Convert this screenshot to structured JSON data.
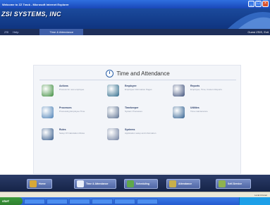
{
  "window": {
    "title": "Welcome to ZZ Track - Microsoft Internet Explorer"
  },
  "banner": {
    "brand": "ZSI SYSTEMS, INC"
  },
  "nav": {
    "items": [
      "ZSI",
      "Help"
    ],
    "active": "Time & Attendance",
    "user": "Guest ZSIS, Exit"
  },
  "panel": {
    "title": "Time and Attendance"
  },
  "modules": [
    {
      "name": "Actions",
      "desc": "Process for new employee",
      "icon": "actions-icon",
      "color": "#3b8b3b"
    },
    {
      "name": "Employee",
      "desc": "Employee Information Pages",
      "icon": "employee-icon",
      "color": "#2d6a8a"
    },
    {
      "name": "Reports",
      "desc": "Employee, Time, Custom Reports",
      "icon": "reports-icon",
      "color": "#3d4f7a"
    },
    {
      "name": "Processes",
      "desc": "Processing Employee Time",
      "icon": "processes-icon",
      "color": "#4a7fb5"
    },
    {
      "name": "Timekeeper",
      "desc": "System Processes",
      "icon": "timekeeper-icon",
      "color": "#5a6f8f"
    },
    {
      "name": "Utilities",
      "desc": "Time maintenance",
      "icon": "utilities-icon",
      "color": "#2f5f8f"
    },
    {
      "name": "Rules",
      "desc": "Setup Of Calculation Rules",
      "icon": "rules-icon",
      "color": "#355a8a"
    },
    {
      "name": "Systems",
      "desc": "Application setup and information",
      "icon": "systems-icon",
      "color": "#6f7f9f"
    }
  ],
  "bottom_tabs": [
    {
      "label": "Home",
      "icon": "home-icon",
      "color": "#d7a836"
    },
    {
      "label": "Time & Attendance",
      "icon": "clock-icon",
      "color": "#e8eef9"
    },
    {
      "label": "Scheduling",
      "icon": "calendar-icon",
      "color": "#5fa84b"
    },
    {
      "label": "Attendance",
      "icon": "attendance-icon",
      "color": "#c8b04a"
    },
    {
      "label": "Self-Service",
      "icon": "self-service-icon",
      "color": "#8fb24e"
    }
  ],
  "status": {
    "zone": "Local intranet"
  },
  "taskbar": {
    "start": "start"
  }
}
